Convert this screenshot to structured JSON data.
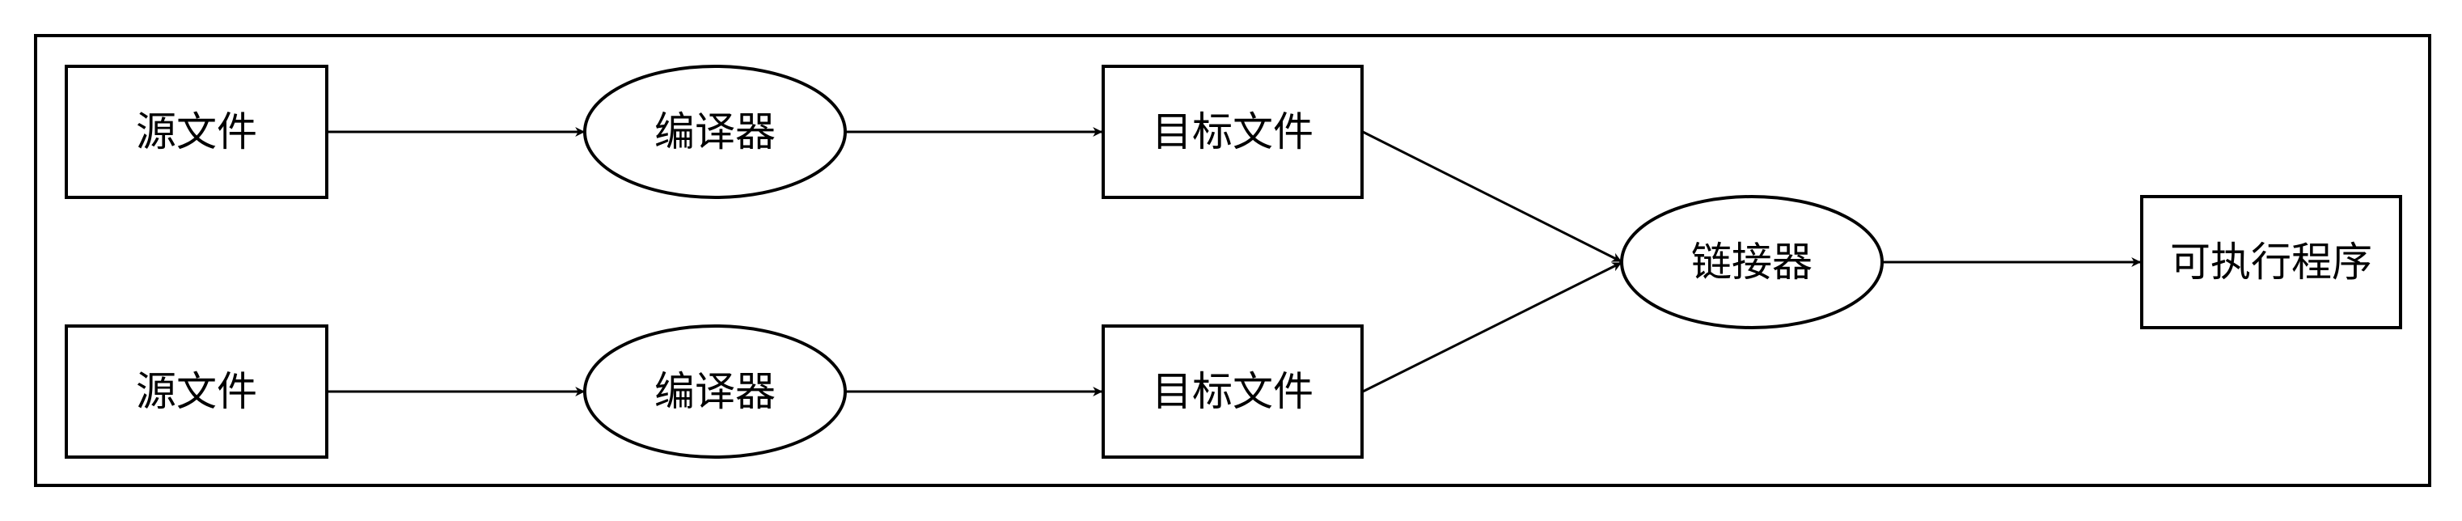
{
  "diagram": {
    "nodes": [
      {
        "id": "src1",
        "label": "源文件",
        "shape": "rect"
      },
      {
        "id": "cmp1",
        "label": "编译器",
        "shape": "ellipse"
      },
      {
        "id": "obj1",
        "label": "目标文件",
        "shape": "rect"
      },
      {
        "id": "src2",
        "label": "源文件",
        "shape": "rect"
      },
      {
        "id": "cmp2",
        "label": "编译器",
        "shape": "ellipse"
      },
      {
        "id": "obj2",
        "label": "目标文件",
        "shape": "rect"
      },
      {
        "id": "link",
        "label": "链接器",
        "shape": "ellipse"
      },
      {
        "id": "exe",
        "label": "可执行程序",
        "shape": "rect"
      }
    ],
    "edges": [
      {
        "from": "src1",
        "to": "cmp1"
      },
      {
        "from": "cmp1",
        "to": "obj1"
      },
      {
        "from": "obj1",
        "to": "link"
      },
      {
        "from": "src2",
        "to": "cmp2"
      },
      {
        "from": "cmp2",
        "to": "obj2"
      },
      {
        "from": "obj2",
        "to": "link"
      },
      {
        "from": "link",
        "to": "exe"
      }
    ],
    "colors": {
      "stroke": "#000000",
      "fill": "#ffffff",
      "text": "#000000"
    }
  }
}
